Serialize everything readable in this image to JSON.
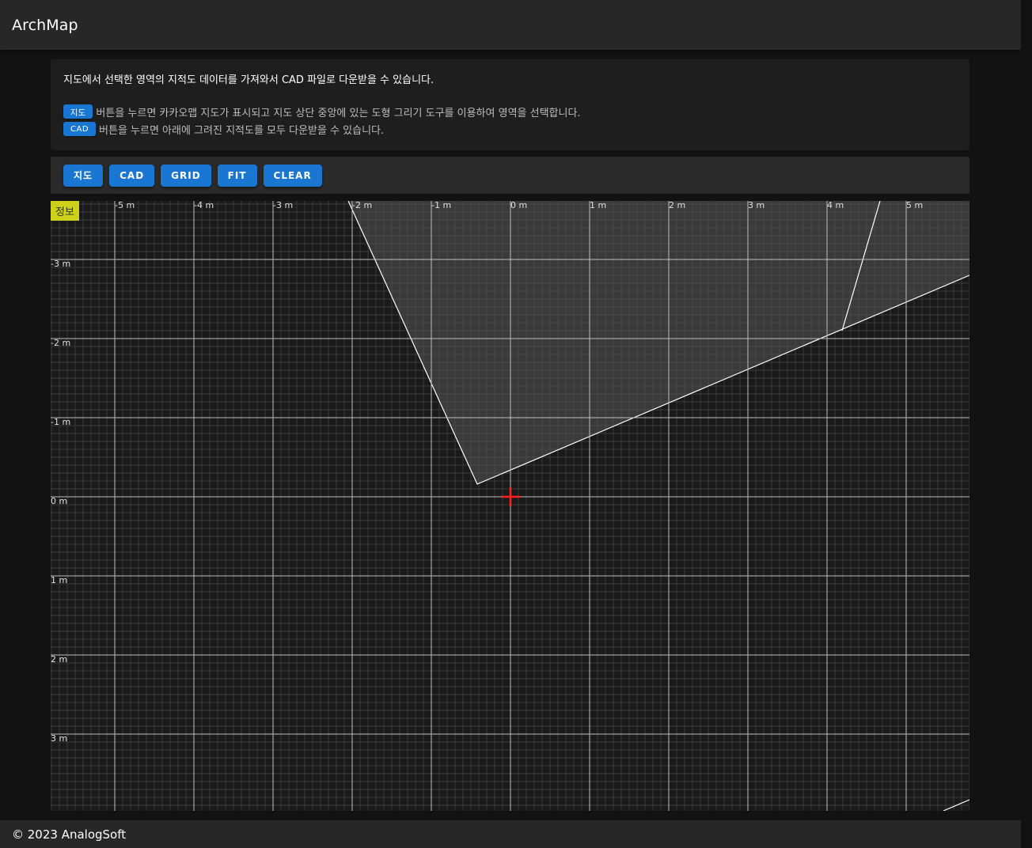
{
  "header": {
    "title": "ArchMap"
  },
  "info": {
    "line1": "지도에서 선택한 영역의 지적도 데이터를 가져와서 CAD 파일로 다운받을 수 있습니다.",
    "map_chip": "지도",
    "map_text": "버튼을 누르면 카카오맵 지도가 표시되고 지도 상단 중앙에 있는 도형 그리기 도구를 이용하여 영역을 선택합니다.",
    "cad_chip": "CAD",
    "cad_text": "버튼을 누르면 아래에 그려진 지적도를 모두 다운받을 수 있습니다."
  },
  "toolbar": {
    "map_label": "지도",
    "cad_label": "CAD",
    "grid_label": "GRID",
    "fit_label": "FIT",
    "clear_label": "CLEAR"
  },
  "canvas": {
    "info_tag": "정보",
    "x_ticks": [
      "-5 m",
      "-4 m",
      "-3 m",
      "-2 m",
      "-1 m",
      "0 m",
      "1 m",
      "2 m",
      "3 m",
      "4 m",
      "5 m"
    ],
    "y_ticks": [
      "-3 m",
      "-2 m",
      "-1 m",
      "0 m",
      "1 m",
      "2 m",
      "3 m"
    ],
    "colors": {
      "crosshair": "#ff2020",
      "parcel_line": "#ffffff",
      "grid_major": "#bdbdbd"
    }
  },
  "footer": {
    "copyright": "© 2023 AnalogSoft"
  }
}
